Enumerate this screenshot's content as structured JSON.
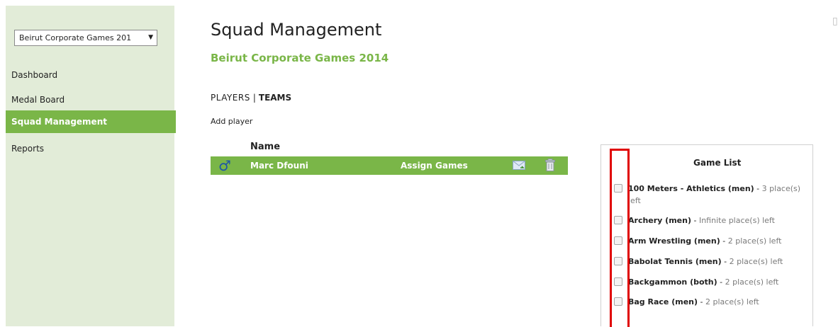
{
  "sidebar": {
    "event_select": {
      "value": "Beirut Corporate Games 201"
    },
    "items": [
      {
        "label": "Dashboard"
      },
      {
        "label": "Medal Board"
      },
      {
        "label": "Squad Management",
        "active": true
      },
      {
        "label": "Reports"
      }
    ]
  },
  "main": {
    "page_title": "Squad Management",
    "event_title": "Beirut Corporate Games 2014",
    "tabs": {
      "players": "PLAYERS",
      "separator": "|",
      "teams": "TEAMS"
    },
    "add_player": "Add player",
    "table": {
      "header_name": "Name",
      "rows": [
        {
          "gender_icon": "male-icon",
          "name": "Marc Dfouni",
          "action": "Assign Games"
        }
      ]
    }
  },
  "game_list": {
    "title": "Game List",
    "items": [
      {
        "name": "100 Meters - Athletics (men)",
        "sep": " - ",
        "places": "3 place(s) left"
      },
      {
        "name": "Archery (men)",
        "sep": " - ",
        "places": "Infinite place(s) left"
      },
      {
        "name": "Arm Wrestling (men)",
        "sep": " - ",
        "places": "2 place(s) left"
      },
      {
        "name": "Babolat Tennis (men)",
        "sep": " - ",
        "places": "2 place(s) left"
      },
      {
        "name": "Backgammon (both)",
        "sep": " - ",
        "places": "2 place(s) left"
      },
      {
        "name": "Bag Race (men)",
        "sep": " - ",
        "places": "2 place(s) left"
      }
    ]
  },
  "colors": {
    "accent": "#7ab648",
    "sidebar_bg": "#e2ecd8",
    "highlight": "#e00000"
  }
}
